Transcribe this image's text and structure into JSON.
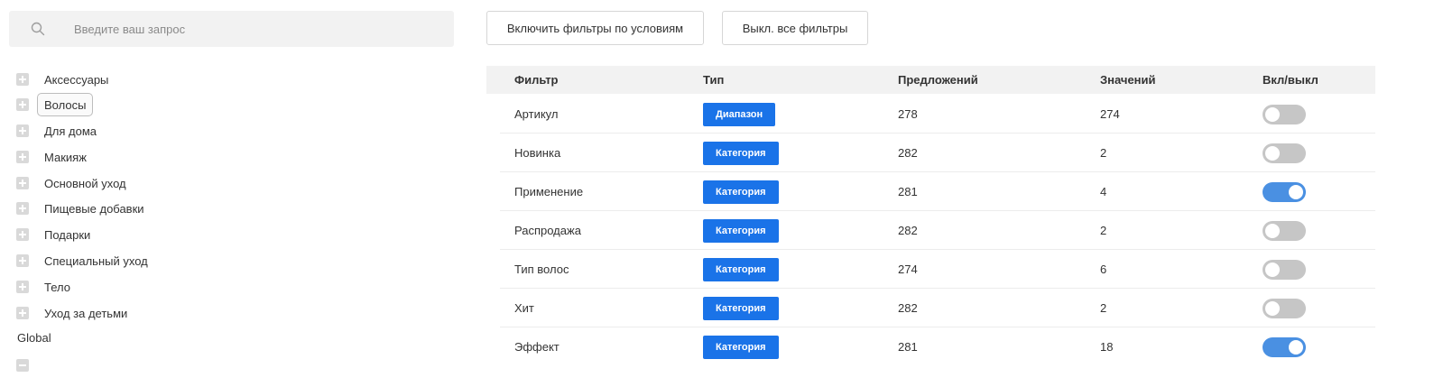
{
  "search": {
    "placeholder": "Введите ваш запрос",
    "value": ""
  },
  "tree": {
    "items": [
      {
        "label": "Аксессуары",
        "selected": false
      },
      {
        "label": "Волосы",
        "selected": true
      },
      {
        "label": "Для дома",
        "selected": false
      },
      {
        "label": "Макияж",
        "selected": false
      },
      {
        "label": "Основной уход",
        "selected": false
      },
      {
        "label": "Пищевые добавки",
        "selected": false
      },
      {
        "label": "Подарки",
        "selected": false
      },
      {
        "label": "Специальный уход",
        "selected": false
      },
      {
        "label": "Тело",
        "selected": false
      },
      {
        "label": "Уход за детьми",
        "selected": false
      }
    ],
    "global_label": "Global"
  },
  "toolbar": {
    "enable_label": "Включить фильтры по условиям",
    "disable_label": "Выкл. все фильтры"
  },
  "table": {
    "headers": {
      "filter": "Фильтр",
      "type": "Тип",
      "offers": "Предложений",
      "values": "Значений",
      "toggle": "Вкл/выкл"
    },
    "rows": [
      {
        "filter": "Артикул",
        "type": "Диапазон",
        "offers": "278",
        "values": "274",
        "enabled": false
      },
      {
        "filter": "Новинка",
        "type": "Категория",
        "offers": "282",
        "values": "2",
        "enabled": false
      },
      {
        "filter": "Применение",
        "type": "Категория",
        "offers": "281",
        "values": "4",
        "enabled": true
      },
      {
        "filter": "Распродажа",
        "type": "Категория",
        "offers": "282",
        "values": "2",
        "enabled": false
      },
      {
        "filter": "Тип волос",
        "type": "Категория",
        "offers": "274",
        "values": "6",
        "enabled": false
      },
      {
        "filter": "Хит",
        "type": "Категория",
        "offers": "282",
        "values": "2",
        "enabled": false
      },
      {
        "filter": "Эффект",
        "type": "Категория",
        "offers": "281",
        "values": "18",
        "enabled": true
      }
    ]
  },
  "colors": {
    "accent": "#1a73e8",
    "toggle_on": "#4a90e2",
    "toggle_off": "#c6c6c6",
    "header_bg": "#f2f2f2"
  },
  "icons": {
    "search": "search-icon",
    "expand": "plus-icon",
    "collapse": "minus-icon"
  }
}
